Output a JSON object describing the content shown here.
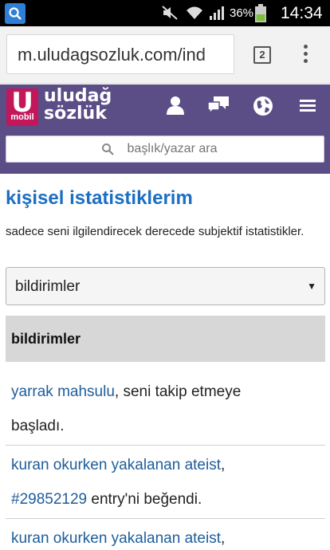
{
  "status_bar": {
    "battery_percent": "36%",
    "time": "14:34",
    "icons": [
      "search-app-icon",
      "mute-icon",
      "wifi-icon",
      "signal-icon",
      "battery-icon"
    ]
  },
  "browser": {
    "url": "m.uludagsozluk.com/ind",
    "tab_count": "2",
    "menu_icon": "overflow-menu-icon"
  },
  "header": {
    "logo_letter": "U",
    "logo_sub": "mobil",
    "brand_line1": "uludağ",
    "brand_line2": "sözlük",
    "icons": [
      "user-icon",
      "messages-icon",
      "globe-icon",
      "hamburger-icon"
    ],
    "search_placeholder": "başlık/yazar ara"
  },
  "colors": {
    "header_bg": "#5b4d86",
    "logo_bg": "#c2185b",
    "title": "#1b6fc2",
    "link": "#1e5d9a"
  },
  "content": {
    "title": "kişisel istatistiklerim",
    "subtitle": "sadece seni ilgilendirecek derecede subjektif istatistikler.",
    "select_value": "bildirimler",
    "section_heading": "bildirimler",
    "notifications": [
      {
        "link": "yarrak mahsulu",
        "text_line1": ", seni takip etmeye",
        "text_line2": "başladı."
      },
      {
        "link": "kuran okurken yakalanan ateist",
        "text_line1": ",",
        "entry": "#29852129",
        "text_line2": " entry'ni beğendi."
      },
      {
        "link": "kuran okurken yakalanan ateist",
        "text_line1": ","
      }
    ]
  }
}
